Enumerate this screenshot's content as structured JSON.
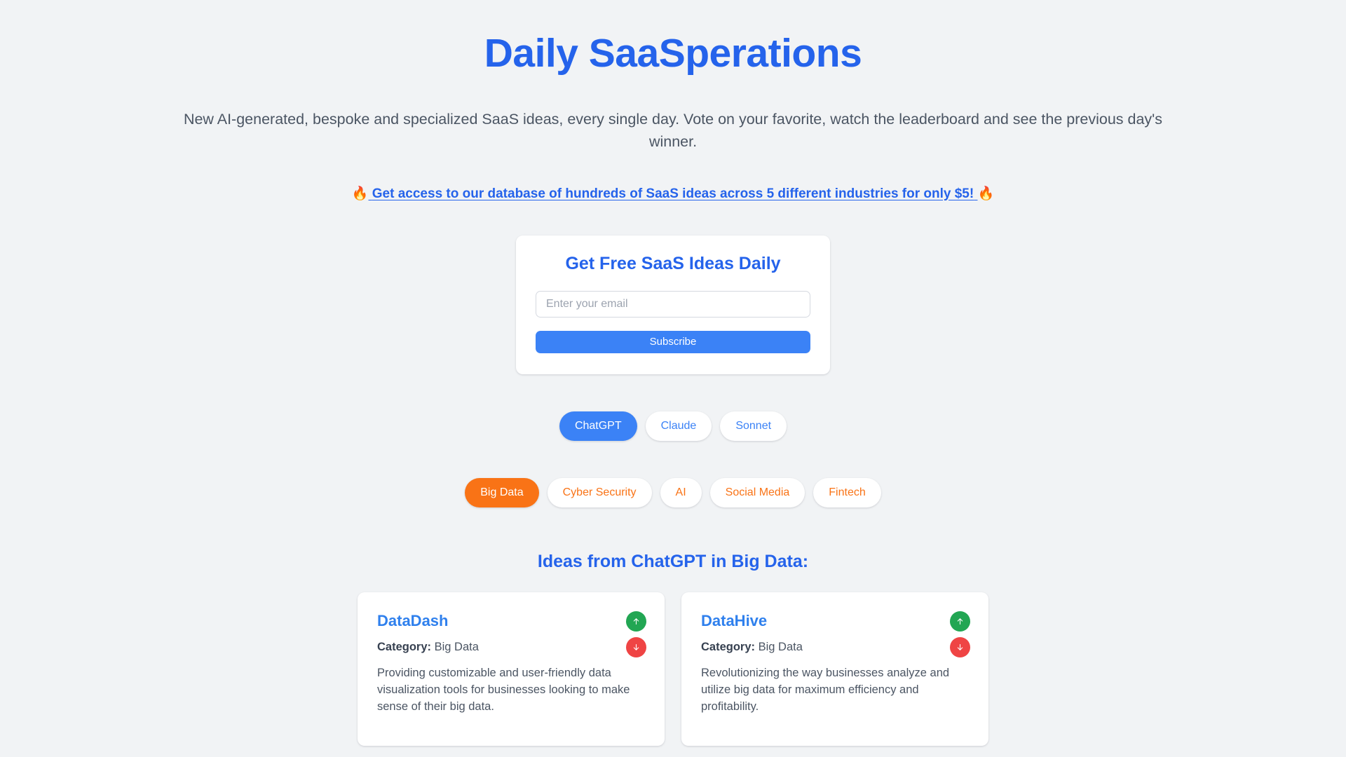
{
  "header": {
    "title": "Daily SaaSperations",
    "subtitle": "New AI-generated, bespoke and specialized SaaS ideas, every single day. Vote on your favorite, watch the leaderboard and see the previous day's winner.",
    "promo": {
      "flame_left": "🔥",
      "text": "Get access to our database of hundreds of SaaS ideas across 5 different industries for only $5!",
      "flame_right": "🔥"
    }
  },
  "subscribe": {
    "title": "Get Free SaaS Ideas Daily",
    "email_placeholder": "Enter your email",
    "email_value": "",
    "button_label": "Subscribe"
  },
  "models": {
    "items": [
      {
        "label": "ChatGPT",
        "active": true
      },
      {
        "label": "Claude",
        "active": false
      },
      {
        "label": "Sonnet",
        "active": false
      }
    ]
  },
  "categories": {
    "items": [
      {
        "label": "Big Data",
        "active": true
      },
      {
        "label": "Cyber Security",
        "active": false
      },
      {
        "label": "AI",
        "active": false
      },
      {
        "label": "Social Media",
        "active": false
      },
      {
        "label": "Fintech",
        "active": false
      }
    ]
  },
  "ideas_section": {
    "heading": "Ideas from ChatGPT in Big Data:",
    "category_label": "Category:",
    "cards": [
      {
        "title": "DataDash",
        "category": "Big Data",
        "description": "Providing customizable and user-friendly data visualization tools for businesses looking to make sense of their big data."
      },
      {
        "title": "DataHive",
        "category": "Big Data",
        "description": "Revolutionizing the way businesses analyze and utilize big data for maximum efficiency and profitability."
      }
    ]
  },
  "colors": {
    "brand_blue": "#2563eb",
    "accent_orange": "#f97316",
    "upvote_green": "#22a653",
    "downvote_red": "#ef4444",
    "page_background": "#f1f3f5"
  }
}
